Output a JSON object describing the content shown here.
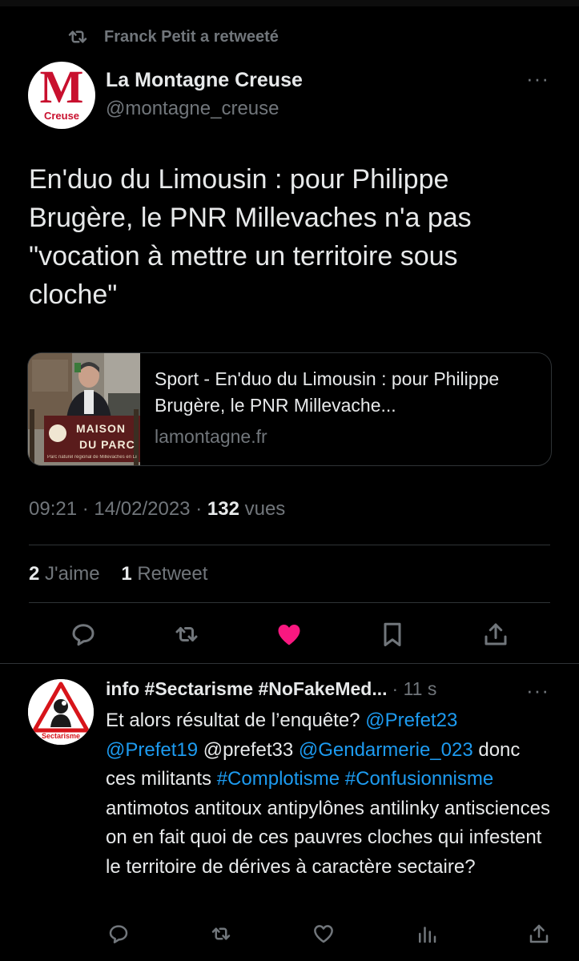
{
  "retweet_context": "Franck Petit a retweeté",
  "tweet": {
    "author_name": "La Montagne Creuse",
    "author_handle": "@montagne_creuse",
    "avatar_letter": "M",
    "avatar_sub": "Creuse",
    "more_label": "···",
    "text": "En'duo du Limousin : pour Philippe Brugère, le PNR Millevaches n'a pas \"vocation à mettre un territoire sous cloche\"",
    "card": {
      "title": "Sport - En'duo du Limousin : pour Philippe Brugère, le PNR Millevache...",
      "domain": "lamontagne.fr",
      "thumb_sign_line1": "MAISON",
      "thumb_sign_line2": "DU PARC",
      "thumb_caption": "Parc naturel régional de Millevaches en Limousin"
    },
    "time": "09:21",
    "date": "14/02/2023",
    "views_count": "132",
    "views_label": "vues",
    "likes_count": "2",
    "likes_label": "J'aime",
    "retweets_count": "1",
    "retweets_label": "Retweet",
    "like_color": "#f91880"
  },
  "reply": {
    "author_name": "info #Sectarisme #NoFakeMed...",
    "time": "· 11 s",
    "avatar_label": "Sectarisme",
    "more_label": "···",
    "segments": [
      {
        "t": "Et alors résultat de l’enquête? ",
        "link": false
      },
      {
        "t": "@Prefet23",
        "link": true
      },
      {
        "t": " ",
        "link": false
      },
      {
        "t": "@Prefet19",
        "link": true
      },
      {
        "t": " @prefet33 ",
        "link": false
      },
      {
        "t": "@Gendarmerie_023",
        "link": true
      },
      {
        "t": " donc ces militants ",
        "link": false
      },
      {
        "t": "#Complotisme",
        "link": true
      },
      {
        "t": " ",
        "link": false
      },
      {
        "t": "#Confusionnisme",
        "link": true
      },
      {
        "t": " antimotos antitoux antipylônes antilinky antisciences on en fait quoi de ces pauvres cloches qui infestent le territoire de dérives à caractère sectaire?",
        "link": false
      }
    ]
  },
  "colors": {
    "background": "#000000",
    "text": "#e7e9ea",
    "secondary": "#71767b",
    "link": "#1d9bf0",
    "divider": "#2f3336"
  }
}
